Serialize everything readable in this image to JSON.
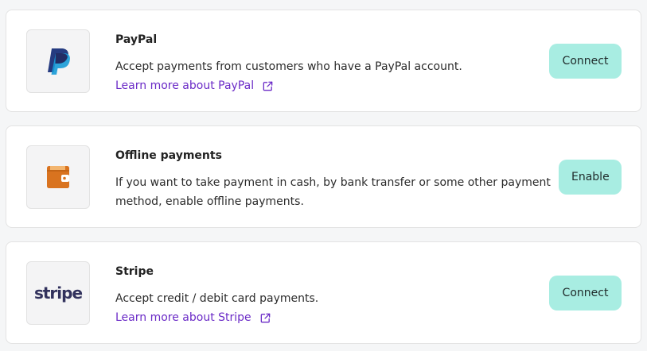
{
  "providers": [
    {
      "title": "PayPal",
      "description": "Accept payments from customers who have a PayPal account.",
      "learn_more": "Learn more about PayPal",
      "action": "Connect",
      "logo_icon": "paypal-logo"
    },
    {
      "title": "Offline payments",
      "description": "If you want to take payment in cash, by bank transfer or some other payment method, enable offline payments.",
      "action": "Enable",
      "logo_icon": "wallet-icon"
    },
    {
      "title": "Stripe",
      "description": "Accept credit / debit card payments.",
      "learn_more": "Learn more about Stripe",
      "action": "Connect",
      "logo_text": "stripe",
      "logo_icon": "stripe-logo"
    }
  ],
  "colors": {
    "button_bg": "#a8ede2",
    "link": "#6b2bc7",
    "paypal_dark": "#253b80",
    "paypal_light": "#179bd7",
    "wallet": "#d9731f",
    "stripe": "#32325d"
  }
}
